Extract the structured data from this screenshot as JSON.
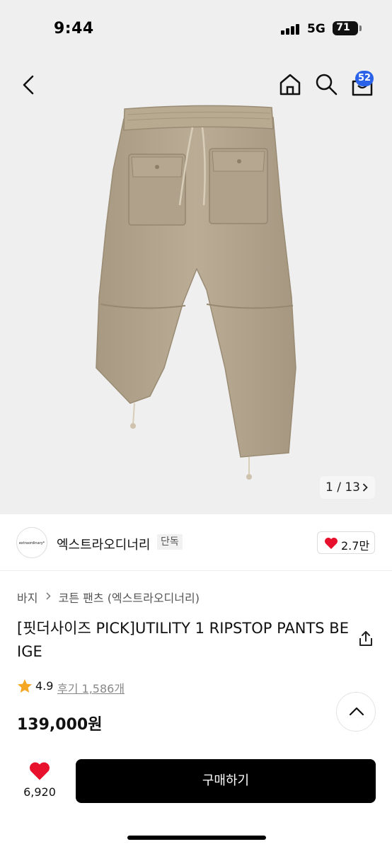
{
  "status_bar": {
    "time": "9:44",
    "network": "5G",
    "battery": "71"
  },
  "header": {
    "cart_count": "52"
  },
  "gallery": {
    "pager": "1 / 13"
  },
  "brand": {
    "logo_text": "extraordinary*",
    "name": "엑스트라오디너리",
    "badge": "단독",
    "likes": "2.7만"
  },
  "breadcrumb": [
    "바지",
    "코튼 팬츠 (엑스트라오디너리)"
  ],
  "product": {
    "title": "[핏더사이즈 PICK]UTILITY 1 RIPSTOP PANTS BEIGE",
    "rating": "4.9",
    "reviews": "후기 1,586개",
    "price": "139,000원"
  },
  "bottom_bar": {
    "wish_count": "6,920",
    "buy_label": "구매하기"
  },
  "colors": {
    "accent_badge": "#2a63e8",
    "heart": "#e8112d",
    "star": "#f5a623",
    "buy_button": "#000000",
    "pants": "#b4a58e"
  },
  "icons": [
    "back-icon",
    "home-icon",
    "search-icon",
    "cart-icon",
    "chevron-right-icon",
    "heart-icon",
    "share-icon",
    "star-icon",
    "chevron-up-icon"
  ]
}
